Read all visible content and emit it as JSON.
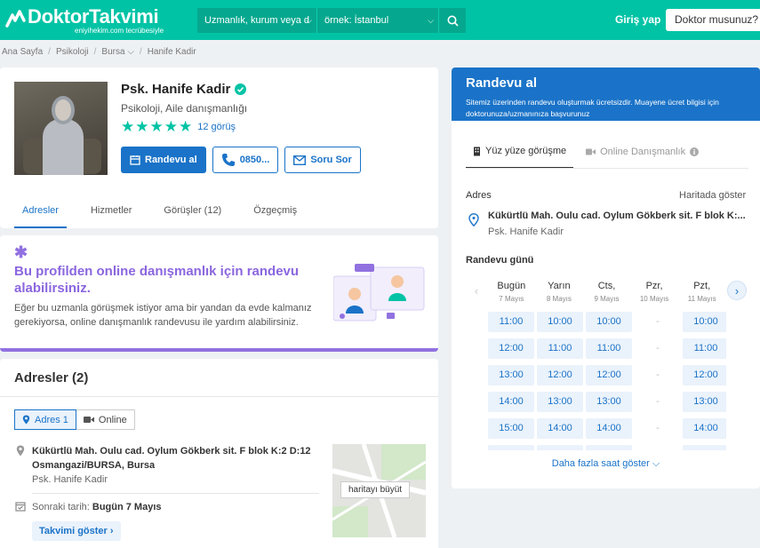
{
  "header": {
    "logo_name": "DoktorTakvimi",
    "logo_sub": "eniyihekim.com tecrübesiyle",
    "search_field_placeholder": "Uzmanlık, kurum veya d",
    "location_field_placeholder": "örnek: İstanbul",
    "login_label": "Giriş yap",
    "doctor_button_label": "Doktor musunuz?",
    "brand_color": "#00c3a5"
  },
  "breadcrumb": [
    "Ana Sayfa",
    "Psikoloji",
    "Bursa",
    "Hanife Kadir"
  ],
  "profile": {
    "name": "Psk. Hanife Kadir",
    "specialty": "Psikoloji, Aile danışmanlığı",
    "rating_stars": 5,
    "reviews_label": "12 görüş",
    "book_label": "Randevu al",
    "phone_label": "0850...",
    "ask_label": "Soru Sor",
    "tabs": [
      "Adresler",
      "Hizmetler",
      "Görüşler (12)",
      "Özgeçmiş"
    ],
    "active_tab": "Adresler"
  },
  "promo": {
    "title": "Bu profilden online danışmanlık için randevu alabilirsiniz.",
    "description": "Eğer bu uzmanla görüşmek istiyor ama bir yandan da evde kalmanız gerekiyorsa, online danışmanlık randevusu ile yardım alabilirsiniz."
  },
  "addresses": {
    "heading": "Adresler (2)",
    "tab_address": "Adres 1",
    "tab_online": "Online",
    "line1": "Kükürtlü Mah. Oulu cad. Oylum Gökberk sit. F blok K:2 D:12",
    "line2": "Osmangazi/BURSA, Bursa",
    "doctor": "Psk. Hanife Kadir",
    "next_label": "Sonraki tarih:",
    "next_value": "Bugün 7 Mayıs",
    "calendar_button": "Takvimi göster",
    "map_button": "haritayı büyüt"
  },
  "booking": {
    "title": "Randevu al",
    "subtitle": "Sitemiz üzerinden randevu oluşturmak ücretsizdir. Muayene ücret bilgisi için doktorunuza/uzmanınıza başvurunuz",
    "tab_in_person": "Yüz yüze görüşme",
    "tab_online": "Online Danışmanlık",
    "address_label": "Adres",
    "map_link": "Haritada göster",
    "address_line": "Kükürtlü Mah. Oulu cad. Oylum Gökberk sit. F blok K:...",
    "address_doctor": "Psk. Hanife Kadir",
    "day_label": "Randevu günü",
    "more_label": "Daha fazla saat göster",
    "days": [
      {
        "name": "Bugün",
        "date": "7 Mayıs",
        "slots": [
          "11:00",
          "12:00",
          "13:00",
          "14:00",
          "15:00"
        ]
      },
      {
        "name": "Yarın",
        "date": "8 Mayıs",
        "slots": [
          "10:00",
          "11:00",
          "12:00",
          "13:00",
          "14:00"
        ]
      },
      {
        "name": "Cts,",
        "date": "9 Mayıs",
        "slots": [
          "10:00",
          "11:00",
          "12:00",
          "13:00",
          "14:00"
        ]
      },
      {
        "name": "Pzr,",
        "date": "10 Mayıs",
        "slots": [
          "-",
          "-",
          "-",
          "-",
          "-"
        ]
      },
      {
        "name": "Pzt,",
        "date": "11 Mayıs",
        "slots": [
          "10:00",
          "11:00",
          "12:00",
          "13:00",
          "14:00"
        ]
      }
    ]
  }
}
